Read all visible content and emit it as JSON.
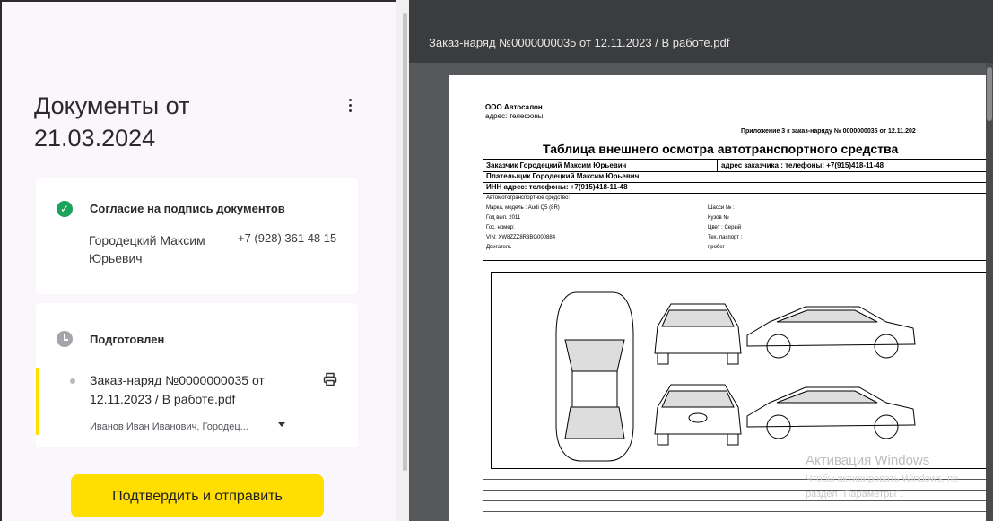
{
  "left_panel": {
    "title": "Документы от 21.03.2024",
    "consent": {
      "label": "Согласие на подпись документов",
      "signer_name": "Городецкий Максим Юрьевич",
      "signer_phone": "+7 (928) 361 48 15"
    },
    "prepared": {
      "label": "Подготовлен",
      "document_name": "Заказ-наряд №0000000035 от 12.11.2023 / В работе.pdf",
      "signers": "Иванов Иван Иванович, Городец..."
    },
    "confirm_button": "Подтвердить и отправить"
  },
  "viewer": {
    "title": "Заказ-наряд №0000000035 от 12.11.2023 / В работе.pdf",
    "pdf": {
      "company": "ООО Автосалон",
      "address_line": "адрес: телефоны:",
      "appendix": "Приложение 3 к заказ-наряду № 0000000035 от 12.11.202",
      "table_title": "Таблица внешнего осмотра автотранспортного средства",
      "customer": "Заказчик Городецкий Максим Юрьевич",
      "customer_address": "адрес заказчика : телефоны: +7(915)418-11-48",
      "payer": "Плательщик Городецкий Максим Юрьевич",
      "inn": "ИНН адрес: телефоны: +7(915)418-11-48",
      "vehicle_header": "Автомототранспортное средство:",
      "make_model": "Марка, модель : Audi Q5 (8R)",
      "year": "Год вып. 2011",
      "plate": "Гос. номер:",
      "vin": "VIN: XW8ZZZ8R3BG000884",
      "engine": "Двигатель",
      "chassis": "Шасси № :",
      "body": "Кузов №",
      "color": "Цвет : Серый",
      "passport": "Тех. паспорт :",
      "mileage": "пробег"
    }
  },
  "watermark": {
    "line1": "Активация Windows",
    "line2": "Чтобы активировать Windows, пе",
    "line3": "раздел \"Параметры\"."
  },
  "icons": {
    "kebab": "more-vertical-icon",
    "check": "check-circle-icon",
    "clock": "clock-icon",
    "print": "printer-icon",
    "caret": "chevron-down-icon"
  },
  "colors": {
    "accent": "#ffde00",
    "success": "#19a35b",
    "pending": "#a4a5ab",
    "viewer_bg": "#56585c"
  }
}
